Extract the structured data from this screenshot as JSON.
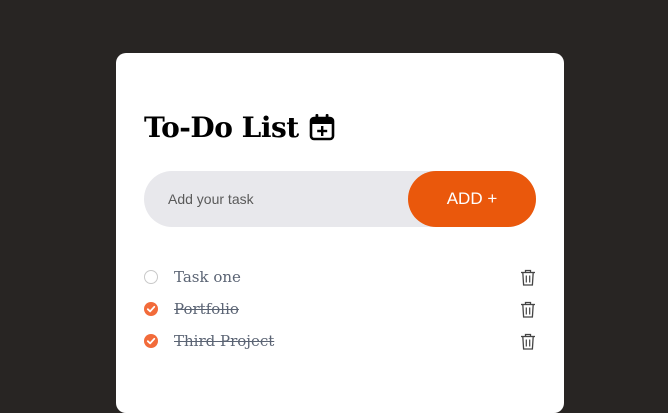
{
  "header": {
    "title": "To-Do List",
    "icon": "calendar-plus-icon"
  },
  "input": {
    "placeholder": "Add your task",
    "value": ""
  },
  "add_button": {
    "label": "ADD +"
  },
  "colors": {
    "background": "#282523",
    "card": "#ffffff",
    "accent": "#ea580c",
    "check": "#f26b3a",
    "input_bg": "#e8e8ec",
    "task_text": "#5b6474"
  },
  "tasks": [
    {
      "text": "Task one",
      "completed": false,
      "delete_icon": "trash-icon"
    },
    {
      "text": "Portfolio",
      "completed": true,
      "delete_icon": "trash-icon"
    },
    {
      "text": "Third Project",
      "completed": true,
      "delete_icon": "trash-icon"
    }
  ]
}
